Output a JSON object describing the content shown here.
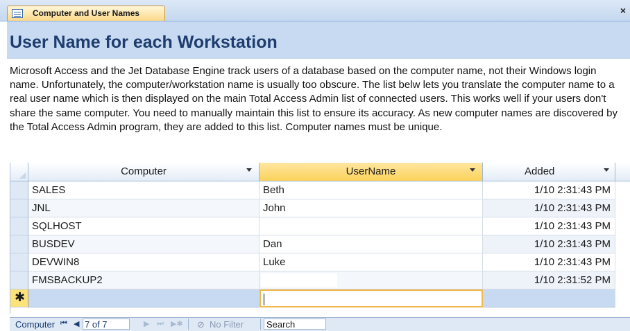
{
  "tab": {
    "label": "Computer and User Names",
    "close": "×"
  },
  "form": {
    "title": "User Name for each Workstation",
    "description": "Microsoft Access and the Jet Database Engine track users of a database based on the computer name, not their Windows login name. Unfortunately, the computer/workstation name is usually too obscure. The list belw lets you translate the computer name to a real user name which is then displayed on the main Total Access Admin list of connected users. This works well if your users don't share the same computer. You need to manually maintain this list to ensure its accuracy. As new computer names are discovered by the Total Access Admin program, they are added to this list. Computer names must be unique."
  },
  "grid": {
    "columns": [
      "Computer",
      "UserName",
      "Added"
    ],
    "rows": [
      {
        "computer": "SALES",
        "username": "Beth",
        "added": "1/10  2:31:43 PM"
      },
      {
        "computer": "JNL",
        "username": "John",
        "added": "1/10  2:31:43 PM"
      },
      {
        "computer": "SQLHOST",
        "username": "",
        "added": "1/10  2:31:43 PM"
      },
      {
        "computer": "BUSDEV",
        "username": "Dan",
        "added": "1/10  2:31:43 PM"
      },
      {
        "computer": "DEVWIN8",
        "username": "Luke",
        "added": "1/10  2:31:43 PM"
      },
      {
        "computer": "FMSBACKUP2",
        "username": "",
        "added": "1/10  2:31:52 PM"
      }
    ],
    "new_row_marker": "✱"
  },
  "navigator": {
    "label": "Computer",
    "record": "7 of 7",
    "first": "⏮",
    "prev": "◀",
    "next": "▶",
    "last": "⏭",
    "new": "▶✱",
    "filter": "No Filter",
    "search": "Search"
  },
  "colors": {
    "header_bg": "#c7daf1",
    "title": "#1e3d6e",
    "selected_header": "#fbd25a",
    "focus_border": "#f2b84b"
  }
}
